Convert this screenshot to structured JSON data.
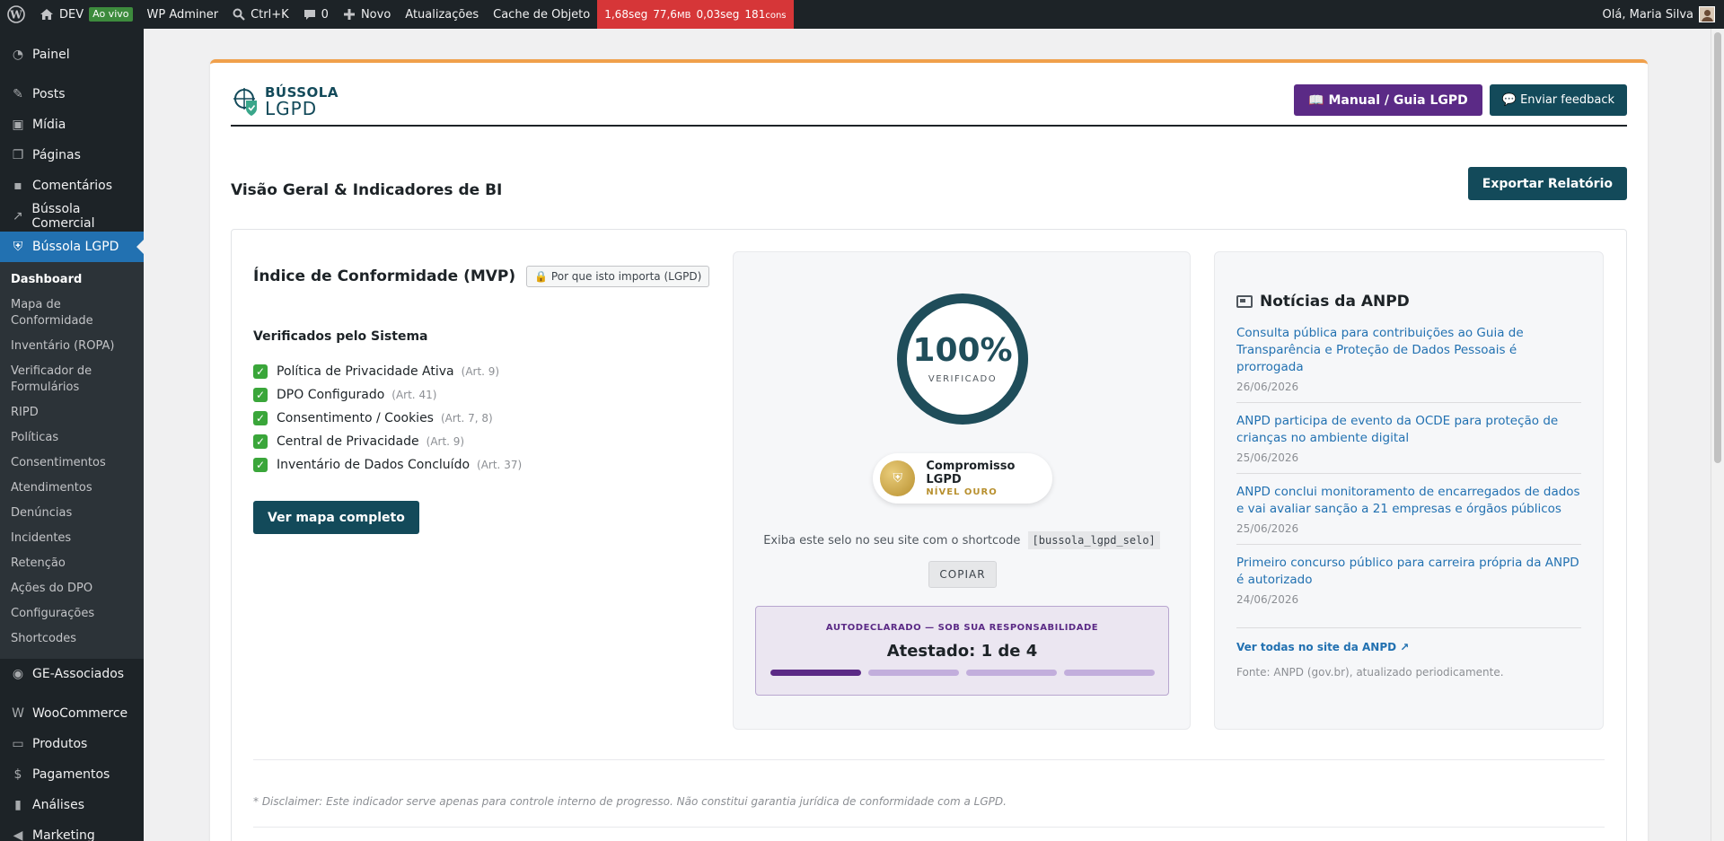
{
  "admin_bar": {
    "site_name": "DEV",
    "live_badge": "Ao vivo",
    "adminer": "WP Adminer",
    "search_shortcut": "Ctrl+K",
    "comments_count": "0",
    "new_label": "Novo",
    "updates": "Atualizações",
    "object_cache": "Cache de Objeto",
    "qm_time": "1,68seg",
    "qm_memory": "77,6",
    "qm_memory_unit": "MB",
    "qm_db_time": "0,03seg",
    "qm_queries": "181",
    "qm_queries_unit": "cons",
    "greeting": "Olá, Maria Silva"
  },
  "sidebar": {
    "items": [
      {
        "label": "Painel",
        "icon": "dashboard-icon"
      },
      {
        "label": "Posts",
        "icon": "pin-icon"
      },
      {
        "label": "Mídia",
        "icon": "media-icon"
      },
      {
        "label": "Páginas",
        "icon": "pages-icon"
      },
      {
        "label": "Comentários",
        "icon": "comments-icon"
      },
      {
        "label": "Bússola Comercial",
        "icon": "chart-line-icon"
      },
      {
        "label": "Bússola LGPD",
        "icon": "shield-icon"
      }
    ],
    "submenu": [
      "Dashboard",
      "Mapa de Conformidade",
      "Inventário (ROPA)",
      "Verificador de Formulários",
      "RIPD",
      "Políticas",
      "Consentimentos",
      "Atendimentos",
      "Denúncias",
      "Incidentes",
      "Retenção",
      "Ações do DPO",
      "Configurações",
      "Shortcodes"
    ],
    "items_after": [
      {
        "label": "GE-Associados",
        "icon": "globe-icon"
      },
      {
        "label": "WooCommerce",
        "icon": "woo-icon"
      },
      {
        "label": "Produtos",
        "icon": "archive-icon"
      },
      {
        "label": "Pagamentos",
        "icon": "dollar-icon"
      },
      {
        "label": "Análises",
        "icon": "bar-chart-icon"
      },
      {
        "label": "Marketing",
        "icon": "megaphone-icon"
      }
    ]
  },
  "header": {
    "logo_line1": "BÚSSOLA",
    "logo_line2": "LGPD",
    "manual_button": "📖 Manual / Guia LGPD",
    "feedback_button": "💬 Enviar feedback"
  },
  "section_title": "Visão Geral & Indicadores de BI",
  "export_button": "Exportar Relatório",
  "index": {
    "title": "Índice de Conformidade (MVP)",
    "why_button": "🔒 Por que isto importa (LGPD)",
    "verified_title": "Verificados pelo Sistema",
    "checks": [
      {
        "label": "Política de Privacidade Ativa",
        "art": "(Art. 9)"
      },
      {
        "label": "DPO Configurado",
        "art": "(Art. 41)"
      },
      {
        "label": "Consentimento / Cookies",
        "art": "(Art. 7, 8)"
      },
      {
        "label": "Central de Privacidade",
        "art": "(Art. 9)"
      },
      {
        "label": "Inventário de Dados Concluído",
        "art": "(Art. 37)"
      }
    ],
    "map_button": "Ver mapa completo"
  },
  "score": {
    "percent": "100%",
    "percent_value": 100,
    "label": "VERIFICADO",
    "seal_title": "Compromisso LGPD",
    "seal_level": "NÍVEL OURO",
    "shortcode_text": "Exiba este selo no seu site com o shortcode",
    "shortcode": "[bussola_lgpd_selo]",
    "copy_button": "COPIAR",
    "attest_label": "AUTODECLARADO — SOB SUA RESPONSABILIDADE",
    "attest_value": "Atestado: 1 de 4",
    "attest_done": 1,
    "attest_total": 4
  },
  "news": {
    "title": "Notícias da ANPD",
    "items": [
      {
        "title": "Consulta pública para contribuições ao Guia de Transparência e Proteção de Dados Pessoais é prorrogada",
        "date": "26/06/2026"
      },
      {
        "title": "ANPD participa de evento da OCDE para proteção de crianças no ambiente digital",
        "date": "25/06/2026"
      },
      {
        "title": "ANPD conclui monitoramento de encarregados de dados e vai avaliar sanção a 21 empresas e órgãos públicos",
        "date": "25/06/2026"
      },
      {
        "title": "Primeiro concurso público para carreira própria da ANPD é autorizado",
        "date": "24/06/2026"
      }
    ],
    "see_all": "Ver todas no site da ANPD ↗",
    "source": "Fonte: ANPD (gov.br), atualizado periodicamente."
  },
  "disclaimer": "* Disclaimer: Este indicador serve apenas para controle interno de progresso. Não constitui garantia jurídica de conformidade com a LGPD.",
  "colors": {
    "admin_dark": "#1d2327",
    "accent_blue": "#2271b1",
    "teal": "#134a5a",
    "purple": "#5b2a86",
    "orange_top": "#f0a04b",
    "gold": "#b8902f"
  }
}
